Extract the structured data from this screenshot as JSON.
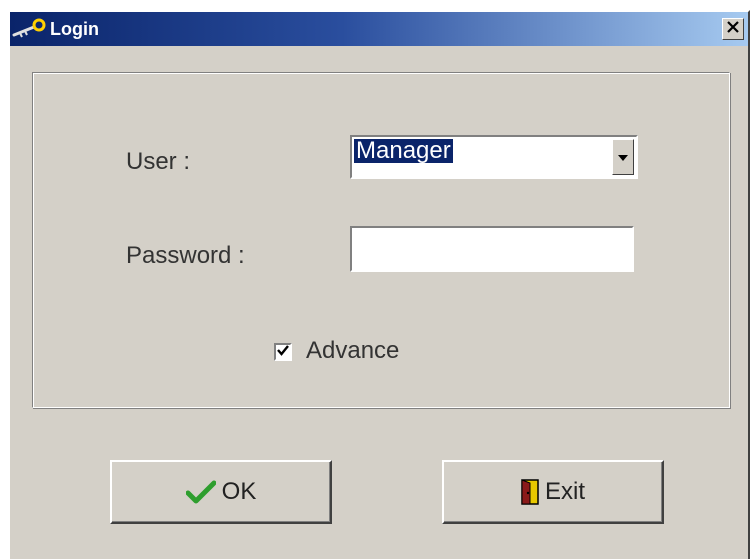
{
  "window": {
    "title": "Login",
    "title_icon": "key-icon",
    "close_icon": "close-icon"
  },
  "form": {
    "user_label": "User :",
    "user_value": "Manager",
    "user_dropdown_icon": "chevron-down-icon",
    "password_label": "Password :",
    "password_value": "",
    "advance_label": "Advance",
    "advance_checked": true
  },
  "buttons": {
    "ok_label": "OK",
    "ok_icon": "checkmark-icon",
    "exit_label": "Exit",
    "exit_icon": "door-exit-icon"
  },
  "colors": {
    "titlebar_start": "#0a246a",
    "titlebar_end": "#a6caf0",
    "face": "#d4d0c8",
    "selection": "#0a246a",
    "ok_check": "#2e9e2e",
    "exit_door": "#e8c800"
  }
}
